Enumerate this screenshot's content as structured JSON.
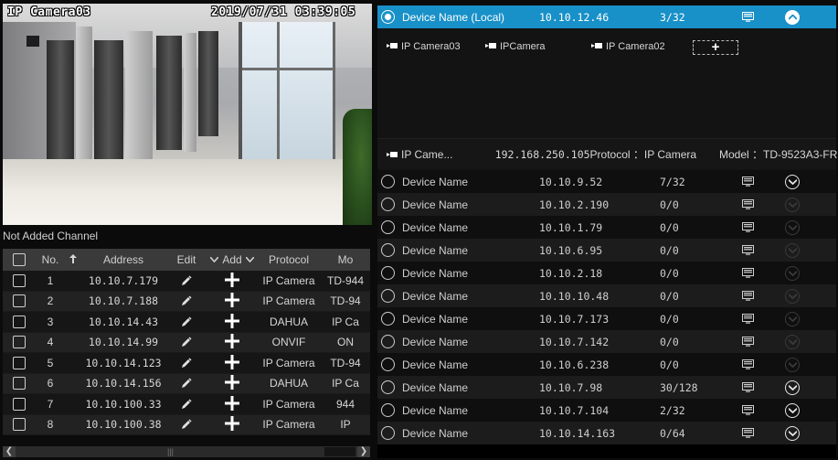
{
  "preview": {
    "osd_name": "IP Camera03",
    "osd_time": "2019/07/31 03:39:05"
  },
  "not_added": {
    "title": "Not Added Channel",
    "headers": {
      "no": "No.",
      "address": "Address",
      "edit": "Edit",
      "add": "Add",
      "protocol": "Protocol",
      "model": "Mo"
    },
    "rows": [
      {
        "no": "1",
        "address": "10.10.7.179",
        "protocol": "IP Camera",
        "model": "TD-944"
      },
      {
        "no": "2",
        "address": "10.10.7.188",
        "protocol": "IP Camera",
        "model": "TD-94"
      },
      {
        "no": "3",
        "address": "10.10.14.43",
        "protocol": "DAHUA",
        "model": "IP Ca"
      },
      {
        "no": "4",
        "address": "10.10.14.99",
        "protocol": "ONVIF",
        "model": "ON"
      },
      {
        "no": "5",
        "address": "10.10.14.123",
        "protocol": "IP Camera",
        "model": "TD-94"
      },
      {
        "no": "6",
        "address": "10.10.14.156",
        "protocol": "DAHUA",
        "model": "IP Ca"
      },
      {
        "no": "7",
        "address": "10.10.100.33",
        "protocol": "IP Camera",
        "model": "944"
      },
      {
        "no": "8",
        "address": "10.10.100.38",
        "protocol": "IP Camera",
        "model": "IP"
      }
    ]
  },
  "devices": {
    "selected": {
      "name": "Device Name (Local)",
      "ip": "10.10.12.46",
      "channels": "3/32"
    },
    "cameras": [
      "IP Camera03",
      "IPCamera",
      "IP Camera02"
    ],
    "add_label": "+",
    "detail": {
      "name": "IP Came...",
      "ip": "192.168.250.105",
      "protocol": "Protocol ：IP Camera",
      "model": "Model ：TD-9523A3-FR"
    },
    "rows": [
      {
        "name": "Device Name",
        "ip": "10.10.9.52",
        "channels": "7/32",
        "expand": "active"
      },
      {
        "name": "Device Name",
        "ip": "10.10.2.190",
        "channels": "0/0",
        "expand": "dim"
      },
      {
        "name": "Device Name",
        "ip": "10.10.1.79",
        "channels": "0/0",
        "expand": "dim"
      },
      {
        "name": "Device Name",
        "ip": "10.10.6.95",
        "channels": "0/0",
        "expand": "dim"
      },
      {
        "name": "Device Name",
        "ip": "10.10.2.18",
        "channels": "0/0",
        "expand": "dim"
      },
      {
        "name": "Device Name",
        "ip": "10.10.10.48",
        "channels": "0/0",
        "expand": "dim"
      },
      {
        "name": "Device Name",
        "ip": "10.10.7.173",
        "channels": "0/0",
        "expand": "dim"
      },
      {
        "name": "Device Name",
        "ip": "10.10.7.142",
        "channels": "0/0",
        "expand": "dim"
      },
      {
        "name": "Device Name",
        "ip": "10.10.6.238",
        "channels": "0/0",
        "expand": "dim"
      },
      {
        "name": "Device Name",
        "ip": "10.10.7.98",
        "channels": "30/128",
        "expand": "active"
      },
      {
        "name": "Device Name",
        "ip": "10.10.7.104",
        "channels": "2/32",
        "expand": "active"
      },
      {
        "name": "Device Name",
        "ip": "10.10.14.163",
        "channels": "0/64",
        "expand": "active"
      }
    ]
  },
  "colors": {
    "accent": "#1890c8",
    "background": "#000000"
  },
  "icons": {
    "monitor": "monitor-icon",
    "camera": "camera-icon",
    "edit": "pencil-icon",
    "add": "plus-icon",
    "expand": "chevron-down-icon",
    "collapse": "chevron-up-icon"
  }
}
